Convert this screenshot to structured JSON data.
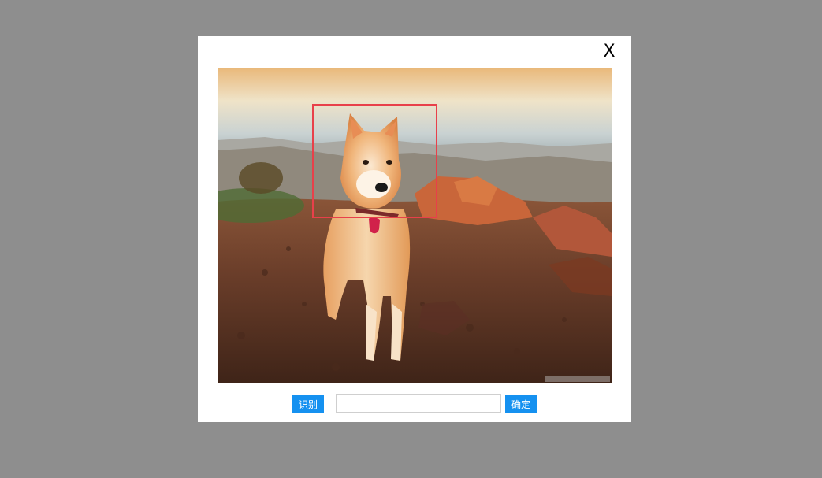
{
  "dialog": {
    "close_label": "X"
  },
  "image": {
    "subject": "dog",
    "detection_box_color": "#e8404a"
  },
  "controls": {
    "recognize_label": "识别",
    "input_value": "",
    "input_placeholder": "",
    "confirm_label": "确定"
  },
  "colors": {
    "overlay": "#8e8e8e",
    "button_bg": "#1591f0",
    "button_text": "#ffffff"
  }
}
